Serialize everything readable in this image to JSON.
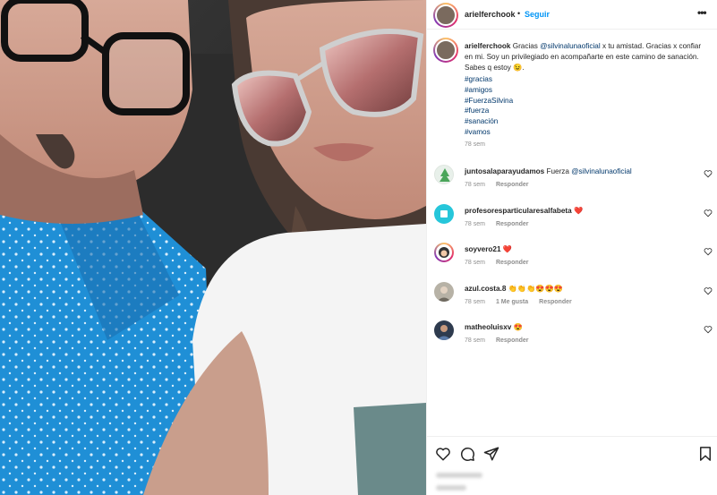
{
  "post": {
    "username": "arielferchook",
    "separator": "•",
    "follow_label": "Seguir",
    "more_label": "•••"
  },
  "caption": {
    "username": "arielferchook",
    "text_before": " Gracias ",
    "mention": "@silvinalunaoficial",
    "text_after": " x tu amistad. Gracias x confiar en mi. Soy un privilegiado en acompañarte en este camino de sanación. Sabes q estoy 😉.",
    "hashtags": [
      "#gracias",
      "#amigos",
      "#FuerzaSilvina",
      "#fuerza",
      "#sanación",
      "#vamos"
    ],
    "time": "78 sem"
  },
  "comments": [
    {
      "username": "juntosalaparayudamos",
      "text": " Fuerza ",
      "mention": "@silvinalunaoficial",
      "time": "78 sem",
      "likes": "",
      "reply": "Responder",
      "avatar_color": "#e8f0ea"
    },
    {
      "username": "profesoresparticularesalfabeta",
      "text": " ❤️",
      "mention": "",
      "time": "78 sem",
      "likes": "",
      "reply": "Responder",
      "avatar_color": "#26c6da"
    },
    {
      "username": "soyvero21",
      "text": " ❤️",
      "mention": "",
      "time": "78 sem",
      "likes": "",
      "reply": "Responder",
      "avatar_color": "#ffffff"
    },
    {
      "username": "azul.costa.8",
      "text": " 👏👏👏😍😍😍",
      "mention": "",
      "time": "78 sem",
      "likes": "1 Me gusta",
      "reply": "Responder",
      "avatar_color": "#b7b2a6"
    },
    {
      "username": "matheoluisxv",
      "text": " 😍",
      "mention": "",
      "time": "78 sem",
      "likes": "",
      "reply": "Responder",
      "avatar_color": "#2e3b4e"
    }
  ],
  "actions": {
    "like_icon": "heart-icon",
    "comment_icon": "comment-icon",
    "share_icon": "share-icon",
    "save_icon": "bookmark-icon"
  },
  "colors": {
    "link": "#0095f6",
    "mention": "#00376b",
    "muted": "#8e8e8e",
    "heart": "#ed4956"
  }
}
